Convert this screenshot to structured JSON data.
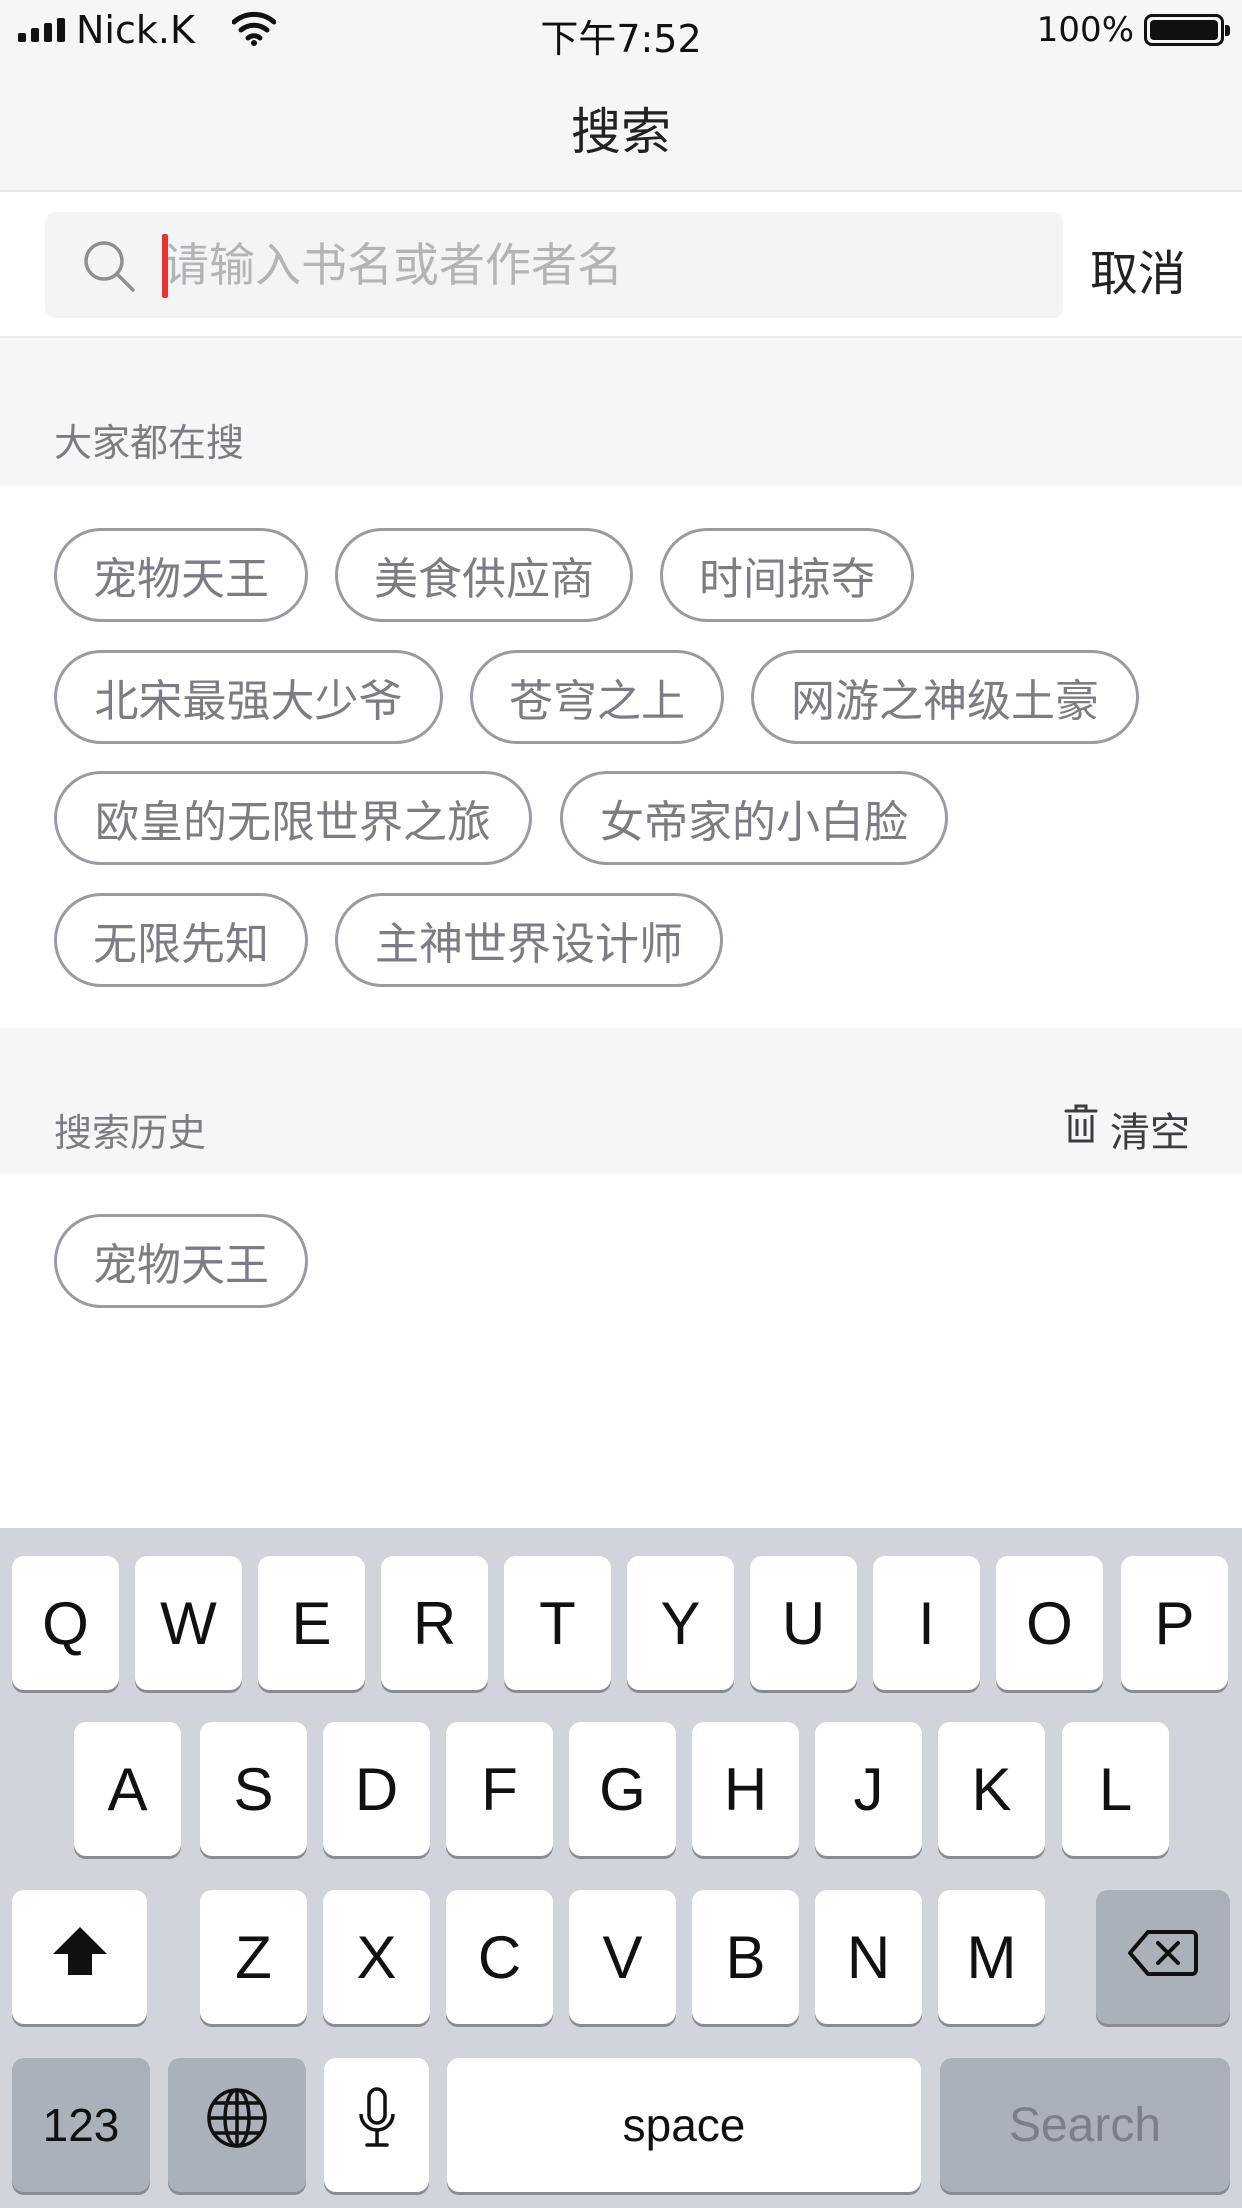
{
  "status_bar": {
    "carrier": "Nick.K",
    "time": "下午7:52",
    "battery_percent": "100%",
    "battery_level": 1.0
  },
  "nav": {
    "title": "搜索"
  },
  "search": {
    "placeholder": "请输入书名或者作者名",
    "value": "",
    "cancel_label": "取消"
  },
  "popular": {
    "title": "大家都在搜",
    "tags": [
      "宠物天王",
      "美食供应商",
      "时间掠夺",
      "北宋最强大少爷",
      "苍穹之上",
      "网游之神级土豪",
      "欧皇的无限世界之旅",
      "女帝家的小白脸",
      "无限先知",
      "主神世界设计师"
    ]
  },
  "history": {
    "title": "搜索历史",
    "clear_label": "清空",
    "tags": [
      "宠物天王"
    ]
  },
  "keyboard": {
    "row1": [
      "Q",
      "W",
      "E",
      "R",
      "T",
      "Y",
      "U",
      "I",
      "O",
      "P"
    ],
    "row2": [
      "A",
      "S",
      "D",
      "F",
      "G",
      "H",
      "J",
      "K",
      "L"
    ],
    "row3": [
      "Z",
      "X",
      "C",
      "V",
      "B",
      "N",
      "M"
    ],
    "numbers_label": "123",
    "space_label": "space",
    "search_label": "Search",
    "icons": {
      "shift": "shift-icon",
      "delete": "backspace-icon",
      "globe": "globe-icon",
      "mic": "microphone-icon"
    }
  },
  "colors": {
    "accent_cursor": "#e8332e",
    "tag_border": "#9a9aa2",
    "keyboard_bg": "#d1d4db"
  }
}
